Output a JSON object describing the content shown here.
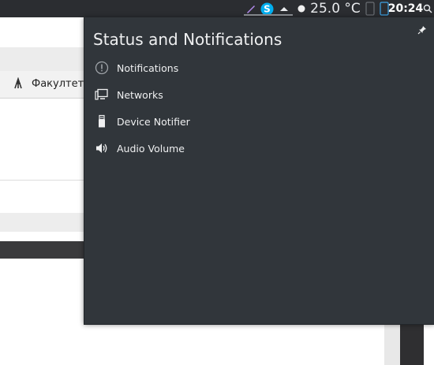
{
  "panel": {
    "temperature": "25.0 °C",
    "clock": "20:24"
  },
  "background_app": {
    "tab_label": "Факултет т"
  },
  "popup": {
    "title": "Status and Notifications",
    "entries": [
      {
        "label": "Notifications",
        "icon": "notification-alert-icon"
      },
      {
        "label": "Networks",
        "icon": "network-monitor-icon"
      },
      {
        "label": "Device Notifier",
        "icon": "usb-drive-icon"
      },
      {
        "label": "Audio Volume",
        "icon": "speaker-volume-icon"
      }
    ]
  },
  "colors": {
    "panel_bg": "#2b2d31",
    "popup_bg": "#31363b",
    "text": "#eff0f1",
    "skype_blue": "#00aff0"
  }
}
